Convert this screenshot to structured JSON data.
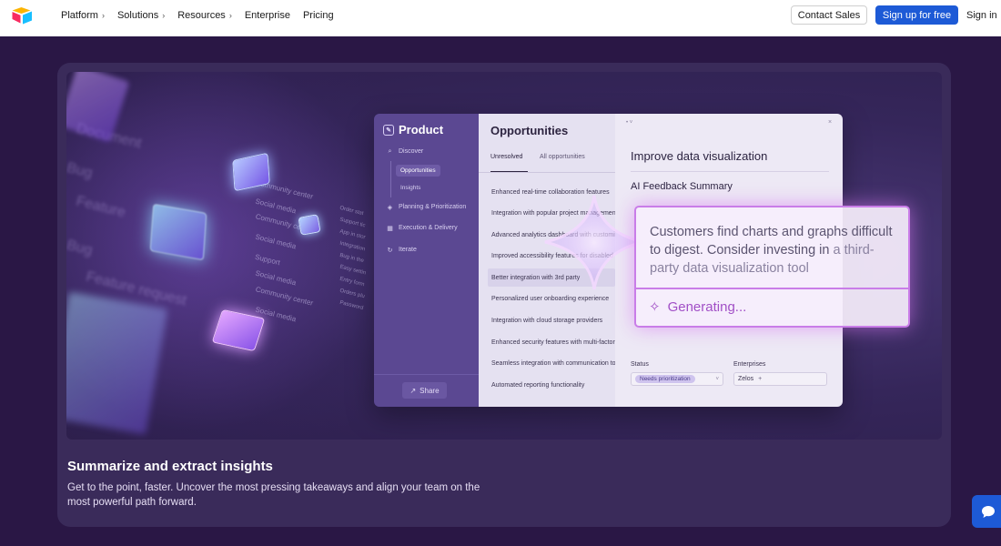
{
  "nav": {
    "links": [
      {
        "label": "Platform",
        "has_chevron": true
      },
      {
        "label": "Solutions",
        "has_chevron": true
      },
      {
        "label": "Resources",
        "has_chevron": true
      },
      {
        "label": "Enterprise",
        "has_chevron": false
      },
      {
        "label": "Pricing",
        "has_chevron": false
      }
    ],
    "contact_sales": "Contact Sales",
    "sign_up": "Sign up for free",
    "sign_in": "Sign in",
    "logo_icon": "airtable-logo",
    "brand_color": "#1d5ad6"
  },
  "hero": {
    "heading": "Summarize and extract insights",
    "description": "Get to the point, faster. Uncover the most pressing takeaways and align your team on the most powerful path forward."
  },
  "background_labels": {
    "small": [
      "Community center",
      "Social media",
      "Community center",
      "Social media",
      "Support",
      "Social media",
      "Community center",
      "Social media",
      "Order stat",
      "Support tic",
      "App in stor",
      "Integration",
      "Bug in the",
      "Easy settin",
      "Entry form",
      "Orders plu",
      "Password"
    ],
    "blurred": [
      "Document",
      "Bug",
      "Feature",
      "Bug",
      "Feature request"
    ]
  },
  "app": {
    "sidebar": {
      "title": "Product",
      "items": [
        {
          "label": "Discover",
          "icon": "search-icon"
        },
        {
          "label": "Planning & Prioritization",
          "icon": "layers-icon"
        },
        {
          "label": "Execution & Delivery",
          "icon": "calendar-icon"
        },
        {
          "label": "Iterate",
          "icon": "refresh-icon"
        }
      ],
      "sub_items": [
        "Opportunities",
        "Insights"
      ],
      "share_label": "Share"
    },
    "list": {
      "title": "Opportunities",
      "tabs": [
        "Unresolved",
        "All opportunities"
      ],
      "rows": [
        "Enhanced real-time collaboration features",
        "Integration with popular project management",
        "Advanced analytics dashboard with customizable",
        "Improved accessibility features for disabled",
        "Better integration with 3rd party",
        "Personalized user onboarding experience",
        "Integration with cloud storage providers",
        "Enhanced security features with multi-factor",
        "Seamless integration with communication tools",
        "Automated reporting functionality"
      ]
    },
    "detail": {
      "title": "Improve data visualization",
      "section": "AI Feedback Summary",
      "status_label": "Status",
      "status_value": "Needs prioritization",
      "enterprises_label": "Enterprises",
      "enterprises_value": "Zelos",
      "dots": "• ˅",
      "close": "×"
    },
    "ai_summary": {
      "text_main": "Customers find charts and graphs difficult to digest. Consider investing in ",
      "text_faded": "a third-party data visualization tool",
      "generating": "Generating...",
      "accent_color": "#c97de8"
    }
  }
}
